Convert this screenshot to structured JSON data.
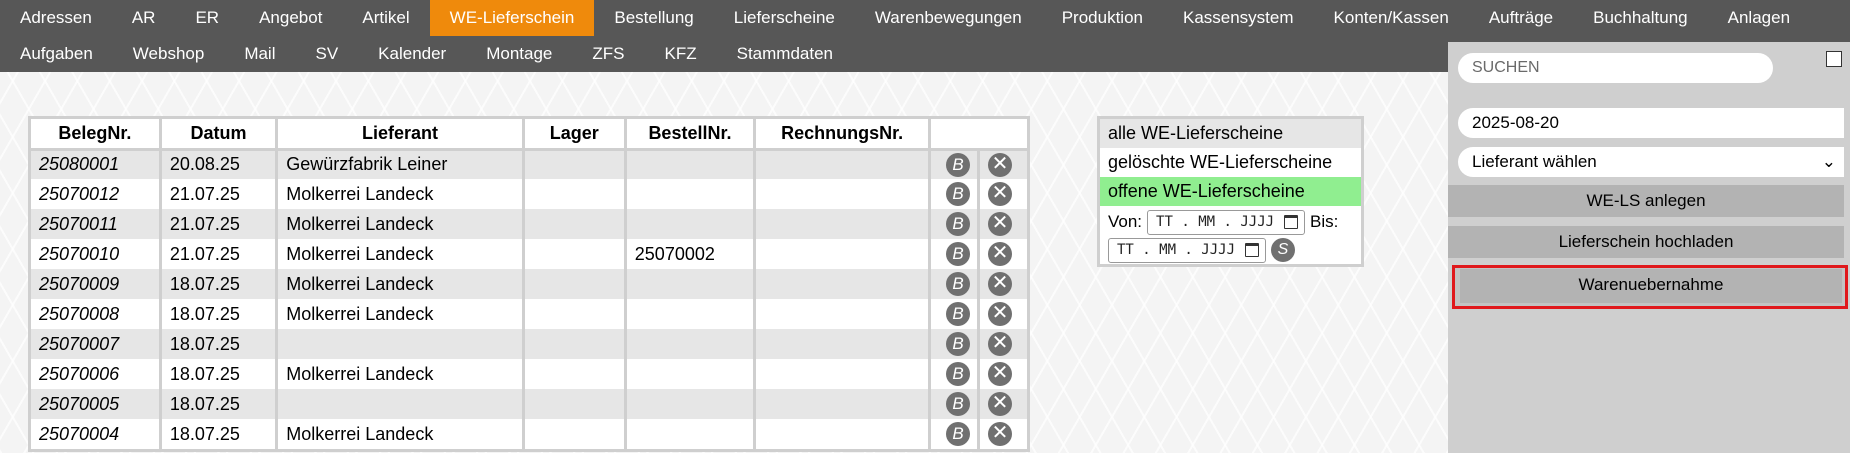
{
  "nav": {
    "row1": [
      "Adressen",
      "AR",
      "ER",
      "Angebot",
      "Artikel",
      "WE-Lieferschein",
      "Bestellung",
      "Lieferscheine",
      "Warenbewegungen",
      "Produktion",
      "Kassensystem",
      "Konten/Kassen",
      "Aufträge",
      "Buchhaltung",
      "Anlagen"
    ],
    "row2": [
      "Aufgaben",
      "Webshop",
      "Mail",
      "SV",
      "Kalender",
      "Montage",
      "ZFS",
      "KFZ",
      "Stammdaten"
    ],
    "active": "WE-Lieferschein"
  },
  "table": {
    "headers": [
      "BelegNr.",
      "Datum",
      "Lieferant",
      "Lager",
      "BestellNr.",
      "RechnungsNr.",
      ""
    ],
    "rows": [
      {
        "beleg": "25080001",
        "datum": "20.08.25",
        "lieferant": "Gewürzfabrik Leiner",
        "lager": "",
        "bestell": "",
        "rechnung": ""
      },
      {
        "beleg": "25070012",
        "datum": "21.07.25",
        "lieferant": "Molkerrei Landeck",
        "lager": "",
        "bestell": "",
        "rechnung": ""
      },
      {
        "beleg": "25070011",
        "datum": "21.07.25",
        "lieferant": "Molkerrei Landeck",
        "lager": "",
        "bestell": "",
        "rechnung": ""
      },
      {
        "beleg": "25070010",
        "datum": "21.07.25",
        "lieferant": "Molkerrei Landeck",
        "lager": "",
        "bestell": "25070002",
        "rechnung": ""
      },
      {
        "beleg": "25070009",
        "datum": "18.07.25",
        "lieferant": "Molkerrei Landeck",
        "lager": "",
        "bestell": "",
        "rechnung": ""
      },
      {
        "beleg": "25070008",
        "datum": "18.07.25",
        "lieferant": "Molkerrei Landeck",
        "lager": "",
        "bestell": "",
        "rechnung": ""
      },
      {
        "beleg": "25070007",
        "datum": "18.07.25",
        "lieferant": "",
        "lager": "",
        "bestell": "",
        "rechnung": ""
      },
      {
        "beleg": "25070006",
        "datum": "18.07.25",
        "lieferant": "Molkerrei Landeck",
        "lager": "",
        "bestell": "",
        "rechnung": ""
      },
      {
        "beleg": "25070005",
        "datum": "18.07.25",
        "lieferant": "",
        "lager": "",
        "bestell": "",
        "rechnung": ""
      },
      {
        "beleg": "25070004",
        "datum": "18.07.25",
        "lieferant": "Molkerrei Landeck",
        "lager": "",
        "bestell": "",
        "rechnung": ""
      }
    ],
    "btn_b": "B",
    "btn_x": "✕"
  },
  "filter": {
    "all": "alle WE-Lieferscheine",
    "deleted": "gelöschte WE-Lieferscheine",
    "open": "offene WE-Lieferscheine",
    "von_label": "Von:",
    "bis_label": "Bis:",
    "date_placeholder": "TT . MM . JJJJ",
    "s_btn": "S"
  },
  "sidebar": {
    "search_placeholder": "SUCHEN",
    "date": "2025-08-20",
    "supplier_select": "Lieferant wählen",
    "btn_create": "WE-LS anlegen",
    "btn_upload": "Lieferschein hochladen",
    "btn_receive": "Warenuebernahme"
  },
  "colors": {
    "nav_bg": "#575757",
    "active_tab": "#ef8a0c",
    "open_filter": "#90ee90",
    "highlight": "#e0181c"
  }
}
